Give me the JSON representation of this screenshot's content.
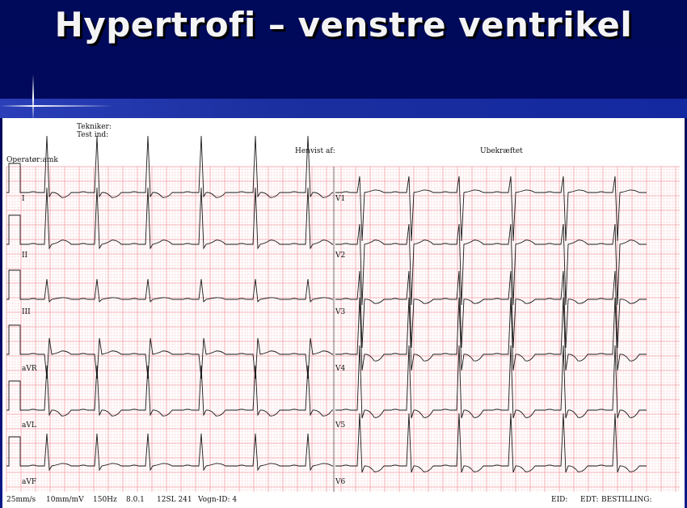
{
  "slide": {
    "title": "Hypertrofi – venstre ventrikel"
  },
  "ecg": {
    "header": {
      "tekniker": "Tekniker:",
      "test_ind": "Test ind:",
      "operator": "Operatør:amk",
      "henvist": "Henvist af:",
      "ubekraeftet": "Ubekræftet"
    },
    "leads_left": [
      "I",
      "II",
      "III",
      "aVR",
      "aVL",
      "aVF"
    ],
    "leads_right": [
      "V1",
      "V2",
      "V3",
      "V4",
      "V5",
      "V6"
    ],
    "footer": {
      "speed": "25mm/s",
      "gain": "10mm/mV",
      "filter": "150Hz",
      "version": "8.0.1",
      "device": "12SL 241",
      "vogn": "Vogn-ID: 4",
      "eid": "EID:",
      "edt": "EDT:",
      "bestilling": "BESTILLING:"
    },
    "colors": {
      "grid_major": "#f2a0a8",
      "grid_minor": "#fbdde0",
      "trace": "#1a1a1a"
    }
  }
}
